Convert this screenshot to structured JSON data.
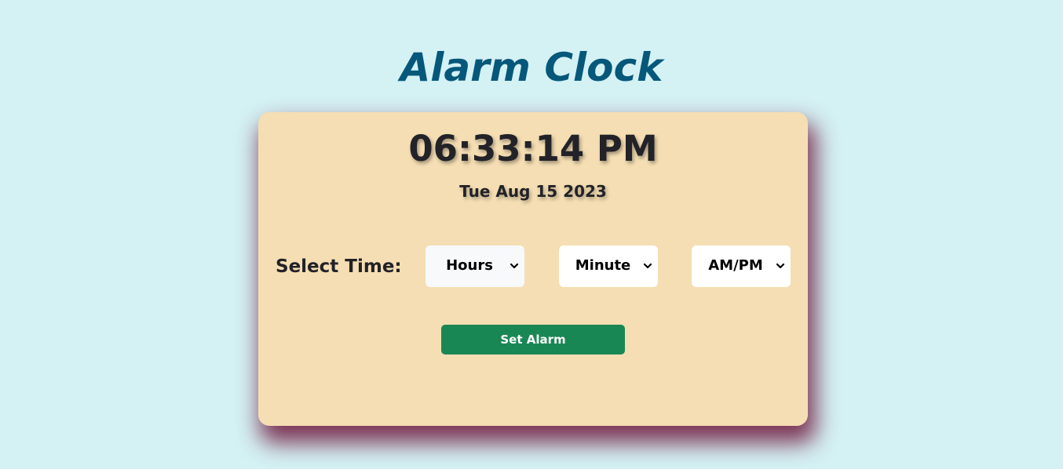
{
  "app": {
    "title": "Alarm Clock"
  },
  "clock": {
    "time": "06:33:14 PM",
    "date": "Tue Aug 15 2023"
  },
  "form": {
    "label": "Select Time:",
    "hours_select": {
      "selected": "Hours"
    },
    "minute_select": {
      "selected": "Minute"
    },
    "ampm_select": {
      "selected": "AM/PM"
    },
    "set_alarm_label": "Set Alarm"
  },
  "colors": {
    "background": "#d4f1f4",
    "title": "#05587a",
    "card": "#f5deb3",
    "card_shadow": "#6e163c",
    "button": "#198754"
  },
  "icons": {
    "select_chevron": "chevron-down-icon"
  }
}
